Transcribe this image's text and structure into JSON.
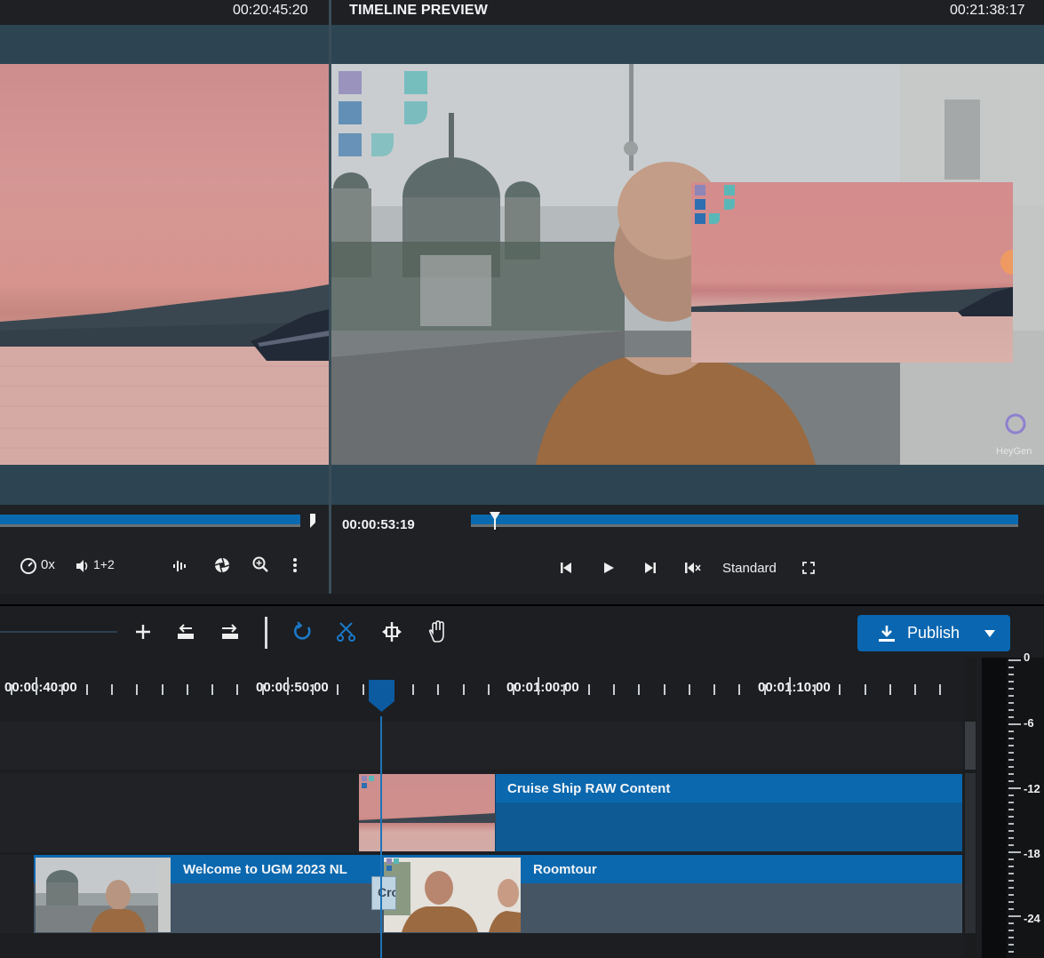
{
  "source_monitor": {
    "timecode": "00:20:45:20",
    "speed_label": "0x",
    "audio_label": "1+2"
  },
  "preview_monitor": {
    "title": "TIMELINE PREVIEW",
    "timecode": "00:21:38:17",
    "current_time": "00:00:53:19",
    "quality_label": "Standard",
    "watermark": "HeyGen"
  },
  "toolbar": {
    "publish_label": "Publish"
  },
  "ruler": {
    "labels": [
      "00:00:40:00",
      "00:00:50:00",
      "00:01:00:00",
      "00:01:10:00"
    ]
  },
  "clips": {
    "cruise": "Cruise Ship RAW Content",
    "welcome": "Welcome to UGM 2023 NL",
    "roomtour": "Roomtour",
    "transition": "Cro"
  },
  "meter": {
    "levels": [
      "0",
      "-6",
      "-12",
      "-18",
      "-24"
    ]
  },
  "colors": {
    "accent": "#0a66b0",
    "clip_header": "#0b68af",
    "stage_bg": "#2d4552"
  }
}
